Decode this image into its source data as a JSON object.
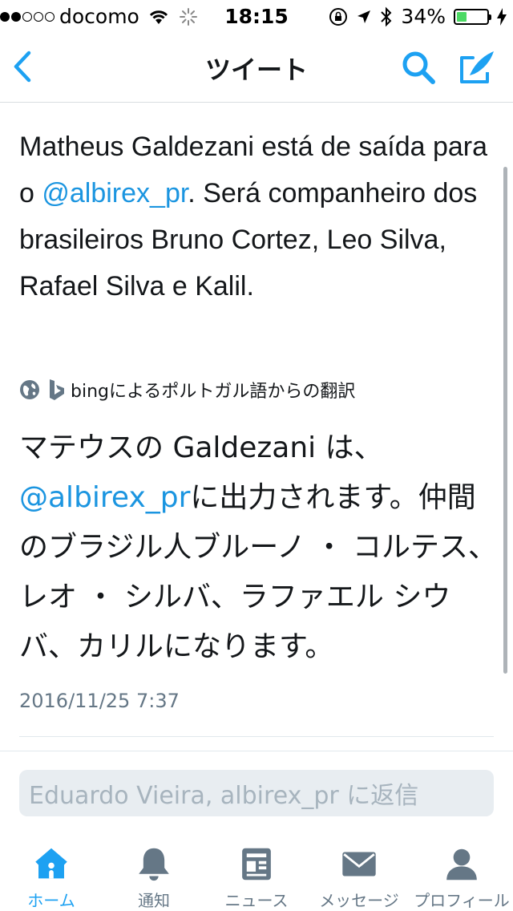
{
  "status_bar": {
    "carrier": "docomo",
    "time": "18:15",
    "battery": "34%",
    "battery_level": 0.34
  },
  "nav": {
    "title": "ツイート"
  },
  "tweet": {
    "text_part1": "Matheus Galdezani está de saída para o ",
    "mention": "@albirex_pr",
    "text_part2": ". Será companheiro dos brasileiros Bruno Cortez, Leo Silva, Rafael Silva e Kalil.",
    "translation_label": "bingによるポルトガル語からの翻訳",
    "translated_part1": "マテウスの Galdezani は、",
    "translated_mention": "@albirex_pr",
    "translated_part2": "に出力されます。仲間のブラジル人ブルーノ ・ コルテス、レオ ・ シルバ、ラファエル シウバ、カリルになります。",
    "timestamp": "2016/11/25 7:37"
  },
  "reply": {
    "placeholder": "Eduardo Vieira, albirex_pr に返信"
  },
  "tabs": [
    {
      "label": "ホーム",
      "icon": "home-icon",
      "active": true
    },
    {
      "label": "通知",
      "icon": "bell-icon",
      "active": false
    },
    {
      "label": "ニュース",
      "icon": "news-icon",
      "active": false
    },
    {
      "label": "メッセージ",
      "icon": "envelope-icon",
      "active": false
    },
    {
      "label": "プロフィール",
      "icon": "profile-icon",
      "active": false
    }
  ],
  "colors": {
    "accent": "#1da1f2",
    "link": "#1b95e0",
    "text": "#14171a",
    "muted": "#657786"
  }
}
